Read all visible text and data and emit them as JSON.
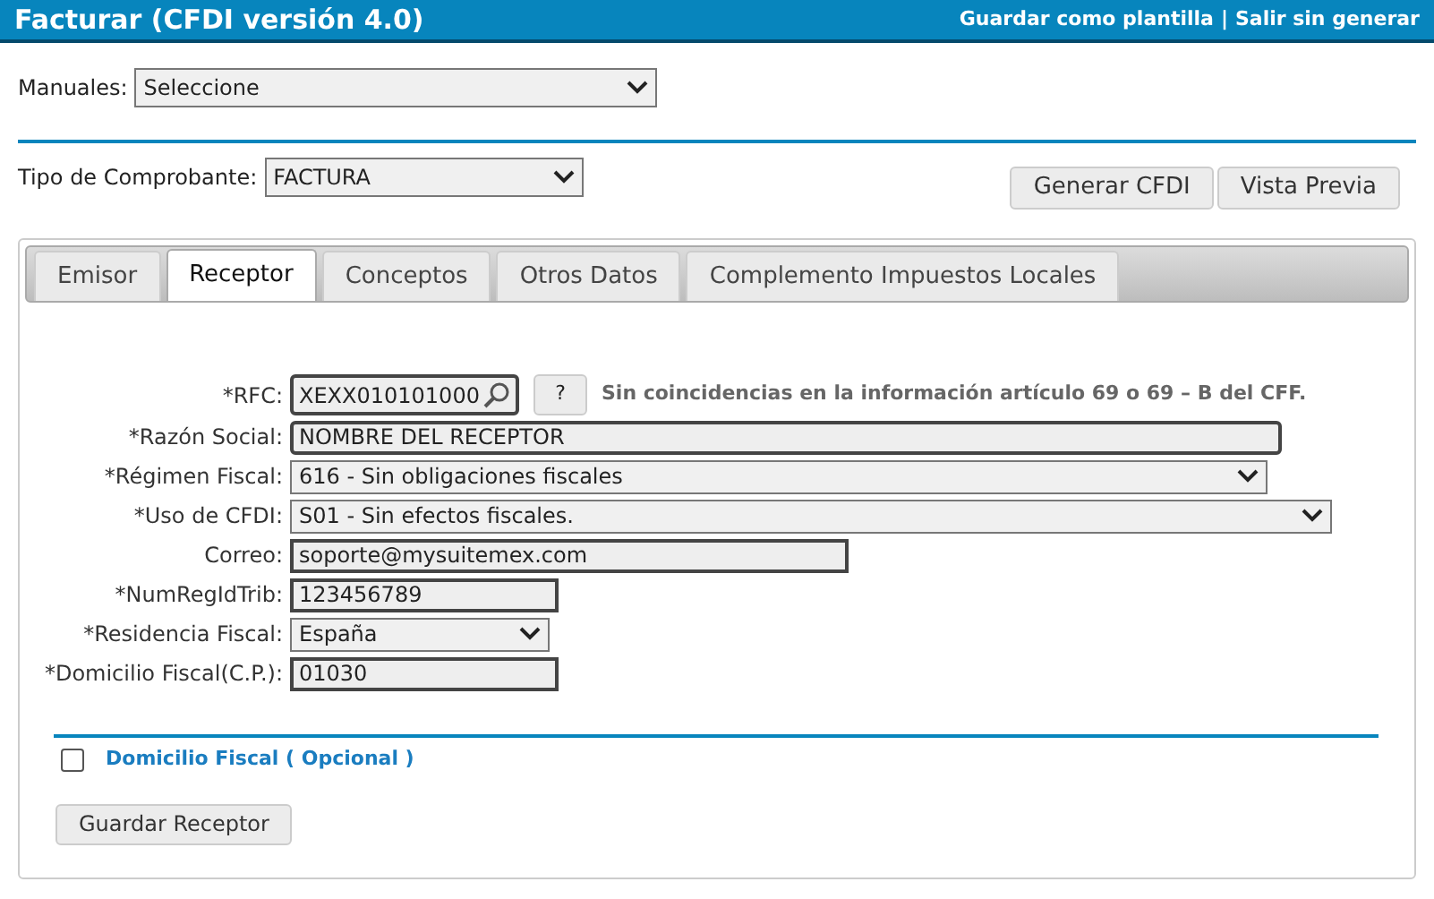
{
  "header": {
    "title": "Facturar (CFDI versión 4.0)",
    "links": [
      "Guardar como plantilla",
      "|",
      "Salir sin generar"
    ]
  },
  "manuales": {
    "label": "Manuales:",
    "value": "Seleccione"
  },
  "tipo_comprobante": {
    "label": "Tipo de Comprobante:",
    "value": "FACTURA"
  },
  "actions": [
    "Generar CFDI",
    "Vista Previa"
  ],
  "tabs": [
    {
      "label": "Emisor",
      "selected": false
    },
    {
      "label": "Receptor",
      "selected": true
    },
    {
      "label": "Conceptos",
      "selected": false
    },
    {
      "label": "Otros Datos",
      "selected": false
    },
    {
      "label": "Complemento Impuestos Locales",
      "selected": false
    }
  ],
  "fields": [
    {
      "kind": "search",
      "label": "*RFC:",
      "value": "XEXX010101000",
      "help": "?",
      "note": "Sin coincidencias en la información artículo 69 o 69 – B del CFF."
    },
    {
      "kind": "text",
      "label": "*Razón Social:",
      "value": "NOMBRE DEL RECEPTOR"
    },
    {
      "kind": "select",
      "label": "*Régimen Fiscal:",
      "value": "616 - Sin obligaciones fiscales"
    },
    {
      "kind": "select",
      "label": "*Uso de CFDI:",
      "value": "S01 - Sin efectos fiscales."
    },
    {
      "kind": "text",
      "label": "Correo:",
      "value": "soporte@mysuitemex.com"
    },
    {
      "kind": "text",
      "label": "*NumRegIdTrib:",
      "value": "123456789"
    },
    {
      "kind": "select",
      "label": "*Residencia Fiscal:",
      "value": "España"
    },
    {
      "kind": "text",
      "label": "*Domicilio Fiscal(C.P.):",
      "value": "01030"
    }
  ],
  "domicilio_opcional": {
    "label": "Domicilio Fiscal ( Opcional )",
    "checked": false
  },
  "save_button": "Guardar Receptor"
}
